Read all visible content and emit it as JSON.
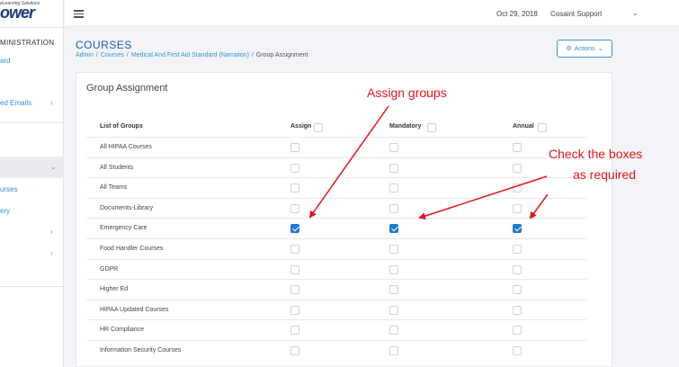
{
  "logo": {
    "tagline": "eLearning Solutions",
    "brand": "ower"
  },
  "sidebar": {
    "heading": "MINISTRATION",
    "items": [
      {
        "label": "ard"
      },
      {
        "label": "ed Emails"
      },
      {
        "label": "urses"
      },
      {
        "label": "ery"
      }
    ]
  },
  "topbar": {
    "date": "Oct 29, 2018",
    "user": "Cosaint Support"
  },
  "header": {
    "title": "COURSES",
    "breadcrumb": [
      "Admin",
      "Courses",
      "Medical And First Aid Standard (Narration)",
      "Group Assignment"
    ],
    "actions_label": "Actions"
  },
  "card": {
    "title": "Group Assignment",
    "columns": {
      "groups": "List of Groups",
      "assign": "Assign",
      "mandatory": "Mandatory",
      "annual": "Annual"
    },
    "rows": [
      {
        "name": "All HIPAA Courses",
        "assign": false,
        "mandatory": false,
        "annual": false
      },
      {
        "name": "All Students",
        "assign": false,
        "mandatory": false,
        "annual": false
      },
      {
        "name": "All Teams",
        "assign": false,
        "mandatory": false,
        "annual": false
      },
      {
        "name": "Documents-Library",
        "assign": false,
        "mandatory": false,
        "annual": false
      },
      {
        "name": "Emergency Care",
        "assign": true,
        "mandatory": true,
        "annual": true
      },
      {
        "name": "Food Handler Courses",
        "assign": false,
        "mandatory": false,
        "annual": false
      },
      {
        "name": "GDPR",
        "assign": false,
        "mandatory": false,
        "annual": false
      },
      {
        "name": "Higher Ed",
        "assign": false,
        "mandatory": false,
        "annual": false
      },
      {
        "name": "HIPAA Updated Courses",
        "assign": false,
        "mandatory": false,
        "annual": false
      },
      {
        "name": "HR Compliance",
        "assign": false,
        "mandatory": false,
        "annual": false
      },
      {
        "name": "Information Security Courses",
        "assign": false,
        "mandatory": false,
        "annual": false
      }
    ]
  },
  "annotations": {
    "assign": "Assign groups",
    "check_line1": "Check the boxes",
    "check_line2": "as required",
    "color": "#e8131b"
  }
}
